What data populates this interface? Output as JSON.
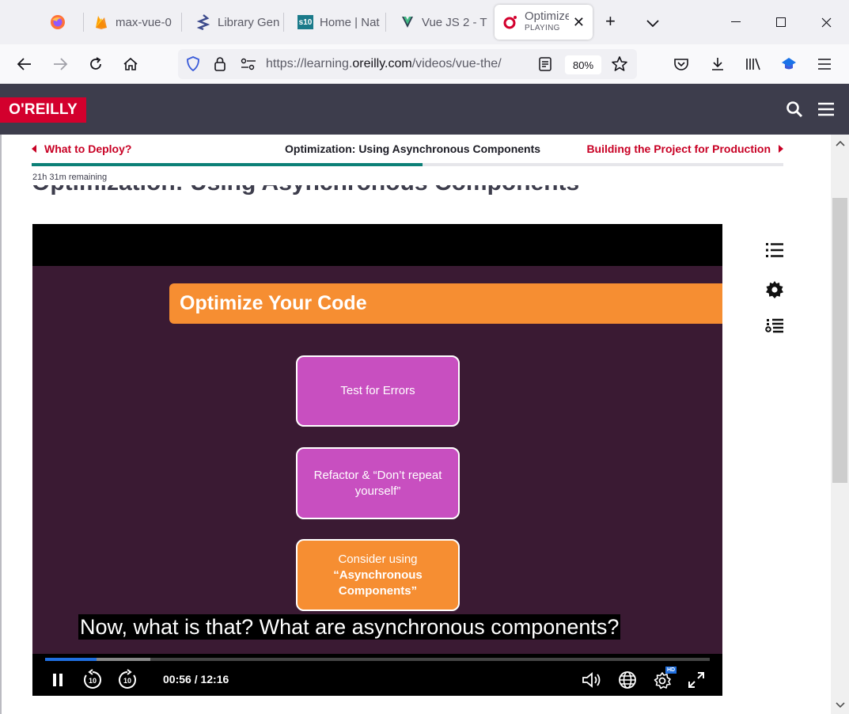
{
  "browser": {
    "tabs": [
      {
        "title": "",
        "icon": "firefox-icon"
      },
      {
        "title": "max-vue-0",
        "icon": "firebase-icon"
      },
      {
        "title": "Library Gen",
        "icon": "library-genesis-icon"
      },
      {
        "title": "Home | Nat",
        "icon": "s10-icon",
        "icon_text": "s10"
      },
      {
        "title": "Vue JS 2 - T",
        "icon": "vue-icon"
      },
      {
        "title": "Optimize",
        "subtitle": "PLAYING",
        "icon": "oreilly-icon",
        "active": true
      }
    ],
    "url_prefix": "https://learning.",
    "url_host": "oreilly.com",
    "url_path": "/videos/vue-the/",
    "zoom": "80%"
  },
  "site": {
    "logo_text": "O'REILLY"
  },
  "course_nav": {
    "prev_label": "What to Deploy?",
    "current_title": "Optimization: Using Asynchronous Components",
    "next_label": "Building the Project for Production",
    "progress_fraction": 0.52,
    "remaining": "21h 31m remaining"
  },
  "page_heading": "Optimization: Using Asynchronous Components",
  "video": {
    "slide_title": "Optimize Your Code",
    "box1": "Test for Errors",
    "box2": "Refactor & “Don’t repeat yourself”",
    "box3_line1": "Consider using",
    "box3_line2": "“Asynchronous Components”",
    "caption": "Now, what is that? What are asynchronous components?",
    "time": "00:56 / 12:16",
    "played_fraction": 0.077,
    "buffered_fraction": 0.158,
    "quality_badge": "HD"
  },
  "colors": {
    "brand_red": "#d3002d",
    "header_bg": "#3d3d4c",
    "progress_green": "#0c8077",
    "slide_bg": "#3a1a33",
    "orange": "#f68e32",
    "purple": "#c84fc0",
    "seek_blue": "#1f6fe0"
  }
}
